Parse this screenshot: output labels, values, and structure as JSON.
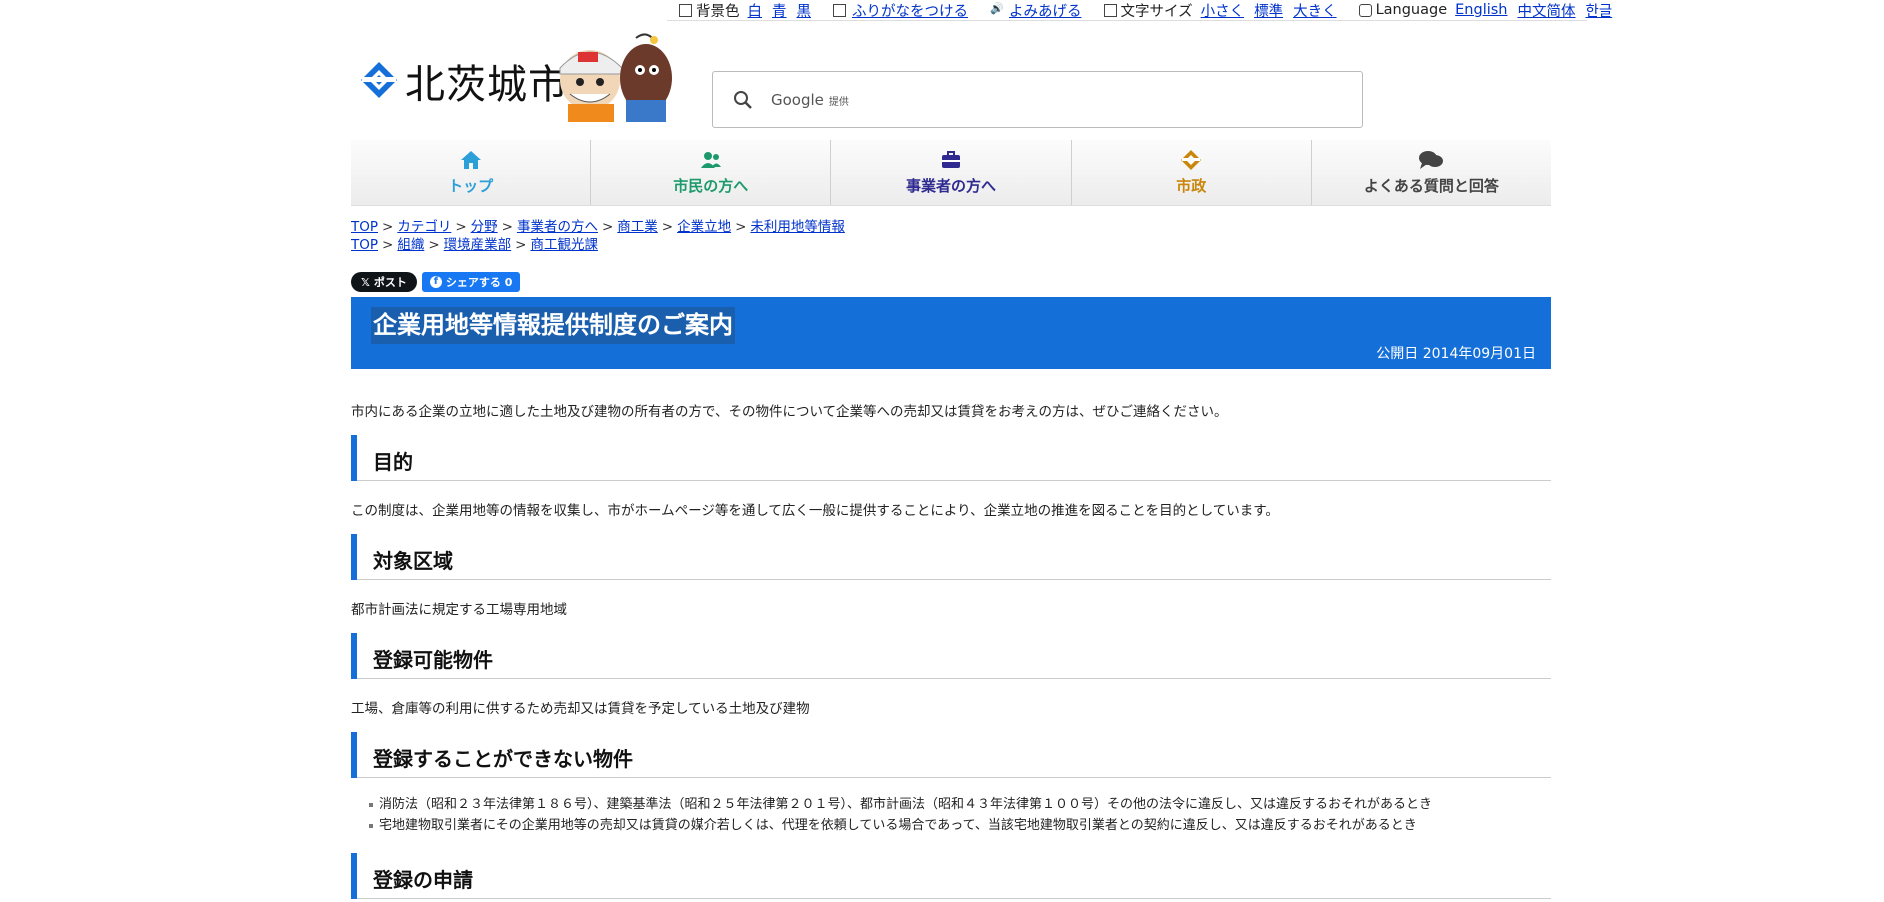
{
  "utility": {
    "bgcolor_label": "背景色",
    "bg_white": "白",
    "bg_blue": "青",
    "bg_black": "黒",
    "furigana": "ふりがなをつける",
    "read_aloud": "よみあげる",
    "font_size_label": "文字サイズ",
    "font_small": "小さく",
    "font_standard": "標準",
    "font_large": "大きく",
    "language_label": "Language",
    "lang_english": "English",
    "lang_chinese": "中文简体",
    "lang_korean": "한글"
  },
  "header": {
    "site_name": "北茨城市",
    "search_provider": "Google",
    "search_provider_suffix": "提供",
    "search_placeholder": ""
  },
  "nav": [
    {
      "label": "トップ",
      "icon": "home-icon",
      "color": "#2a9fd8"
    },
    {
      "label": "市民の方へ",
      "icon": "people-icon",
      "color": "#1d9a6c"
    },
    {
      "label": "事業者の方へ",
      "icon": "briefcase-icon",
      "color": "#2e2a8f"
    },
    {
      "label": "市政",
      "icon": "city-emblem-icon",
      "color": "#c9860b"
    },
    {
      "label": "よくある質問と回答",
      "icon": "chat-bubbles-icon",
      "color": "#444444"
    }
  ],
  "breadcrumbs": {
    "row1": [
      "TOP",
      "カテゴリ",
      "分野",
      "事業者の方へ",
      "商工業",
      "企業立地",
      "未利用地等情報"
    ],
    "row2": [
      "TOP",
      "組織",
      "環境産業部",
      "商工観光課"
    ],
    "separator": ">"
  },
  "share": {
    "x_label": "ポスト",
    "fb_label": "シェアする 0"
  },
  "page": {
    "title": "企業用地等情報提供制度のご案内",
    "published": "公開日 2014年09月01日",
    "intro": "市内にある企業の立地に適した土地及び建物の所有者の方で、その物件について企業等への売却又は賃貸をお考えの方は、ぜひご連絡ください。"
  },
  "sections": {
    "purpose": {
      "heading": "目的",
      "text": "この制度は、企業用地等の情報を収集し、市がホームページ等を通して広く一般に提供することにより、企業立地の推進を図ることを目的としています。"
    },
    "area": {
      "heading": "対象区域",
      "text": "都市計画法に規定する工場専用地域"
    },
    "eligible": {
      "heading": "登録可能物件",
      "text": "工場、倉庫等の利用に供するため売却又は賃貸を予定している土地及び建物"
    },
    "ineligible": {
      "heading": "登録することができない物件",
      "items": [
        "消防法（昭和２３年法律第１８６号）、建築基準法（昭和２５年法律第２０１号）、都市計画法（昭和４３年法律第１００号）その他の法令に違反し、又は違反するおそれがあるとき",
        "宅地建物取引業者にその企業用地等の売却又は賃貸の媒介若しくは、代理を依頼している場合であって、当該宅地建物取引業者との契約に違反し、又は違反するおそれがあるとき"
      ]
    },
    "apply": {
      "heading": "登録の申請"
    }
  },
  "colors": {
    "accent": "#1470d8",
    "link": "#0033cc"
  }
}
